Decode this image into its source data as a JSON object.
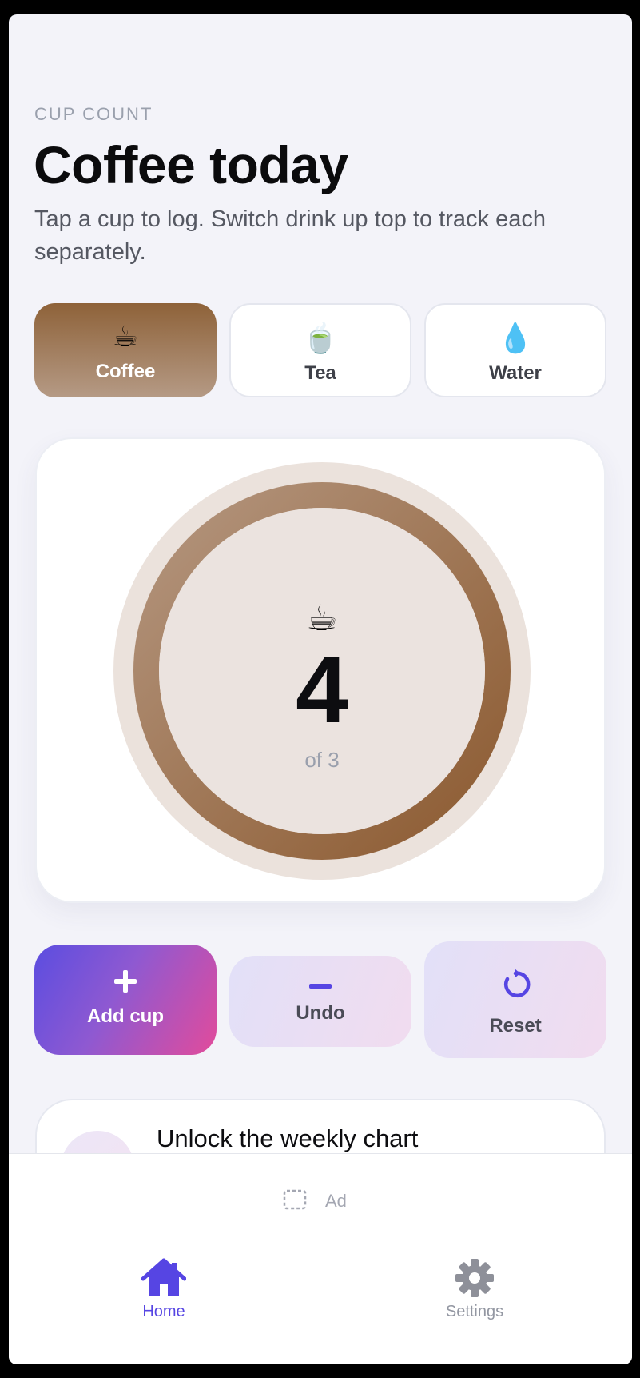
{
  "header": {
    "eyebrow": "CUP COUNT",
    "title": "Coffee today",
    "subtitle": "Tap a cup to log. Switch drink up top to track each separately."
  },
  "drink_tabs": [
    {
      "label": "Coffee",
      "emoji": "☕",
      "icon": "coffee-cup-icon",
      "active": true
    },
    {
      "label": "Tea",
      "emoji": "🍵",
      "icon": "tea-cup-icon",
      "active": false
    },
    {
      "label": "Water",
      "emoji": "💧",
      "icon": "water-drop-icon",
      "active": false
    }
  ],
  "counter": {
    "emoji": "☕",
    "count": "4",
    "goal_text": "of 3",
    "progress": 1.0
  },
  "actions": {
    "add_label": "Add cup",
    "undo_label": "Undo",
    "reset_label": "Reset"
  },
  "promo": {
    "title": "Unlock the weekly chart"
  },
  "ad": {
    "label": "Ad"
  },
  "nav": {
    "home_label": "Home",
    "settings_label": "Settings"
  },
  "colors": {
    "accent": "#5645e3",
    "coffee_brown": "#8e6239",
    "add_gradient_start": "#5b4de0",
    "add_gradient_end": "#e24b9b"
  }
}
